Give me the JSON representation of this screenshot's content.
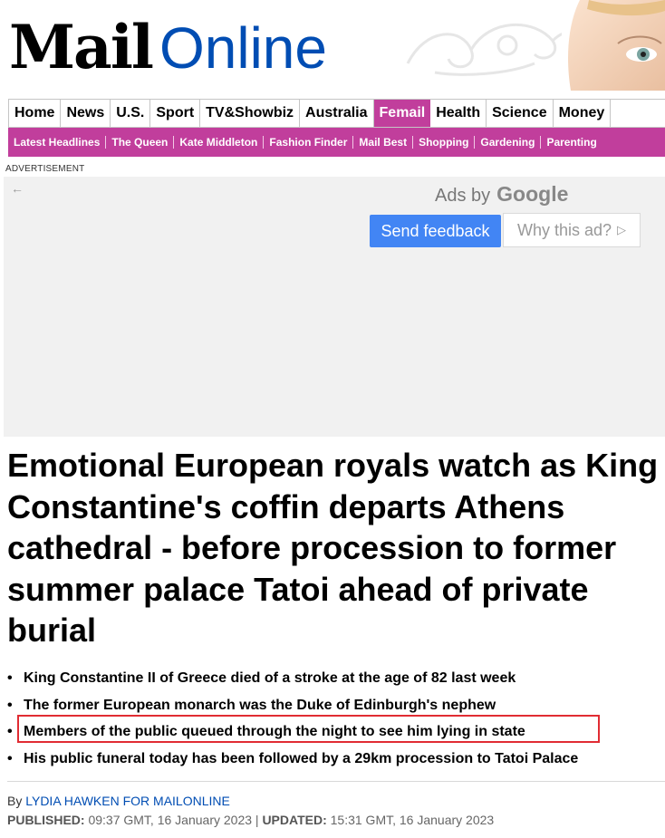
{
  "masthead": {
    "logo_mail": "Mail",
    "logo_online": "Online"
  },
  "nav_primary": [
    {
      "label": "Home",
      "active": false
    },
    {
      "label": "News",
      "active": false
    },
    {
      "label": "U.S.",
      "active": false
    },
    {
      "label": "Sport",
      "active": false
    },
    {
      "label": "TV&Showbiz",
      "active": false
    },
    {
      "label": "Australia",
      "active": false
    },
    {
      "label": "Femail",
      "active": true
    },
    {
      "label": "Health",
      "active": false
    },
    {
      "label": "Science",
      "active": false
    },
    {
      "label": "Money",
      "active": false
    }
  ],
  "nav_secondary": [
    "Latest Headlines",
    "The Queen",
    "Kate Middleton",
    "Fashion Finder",
    "Mail Best",
    "Shopping",
    "Gardening",
    "Parenting"
  ],
  "ad": {
    "label": "ADVERTISEMENT",
    "ads_by": "Ads by",
    "google": "Google",
    "send_feedback": "Send feedback",
    "why_this_ad": "Why this ad?"
  },
  "article": {
    "headline": "Emotional European royals watch as King Constantine's coffin departs Athens cathedral - before procession to former summer palace Tatoi ahead of private burial",
    "bullets": [
      "King Constantine II of Greece died of a stroke at the age of 82 last week",
      "The former European monarch was the Duke of Edinburgh's nephew",
      "Members of the public queued through the night to see him lying in state",
      "His public funeral today has been followed by a 29km procession to Tatoi Palace"
    ],
    "byline_prefix": "By",
    "author": "LYDIA HAWKEN FOR MAILONLINE",
    "published_label": "PUBLISHED:",
    "published": "09:37 GMT, 16 January 2023",
    "separator": "|",
    "updated_label": "UPDATED:",
    "updated": "15:31 GMT, 16 January 2023"
  },
  "colors": {
    "femail_pink": "#c13e9c",
    "brand_blue": "#004db3",
    "google_blue": "#4285f4",
    "highlight_red": "#e12c33"
  }
}
